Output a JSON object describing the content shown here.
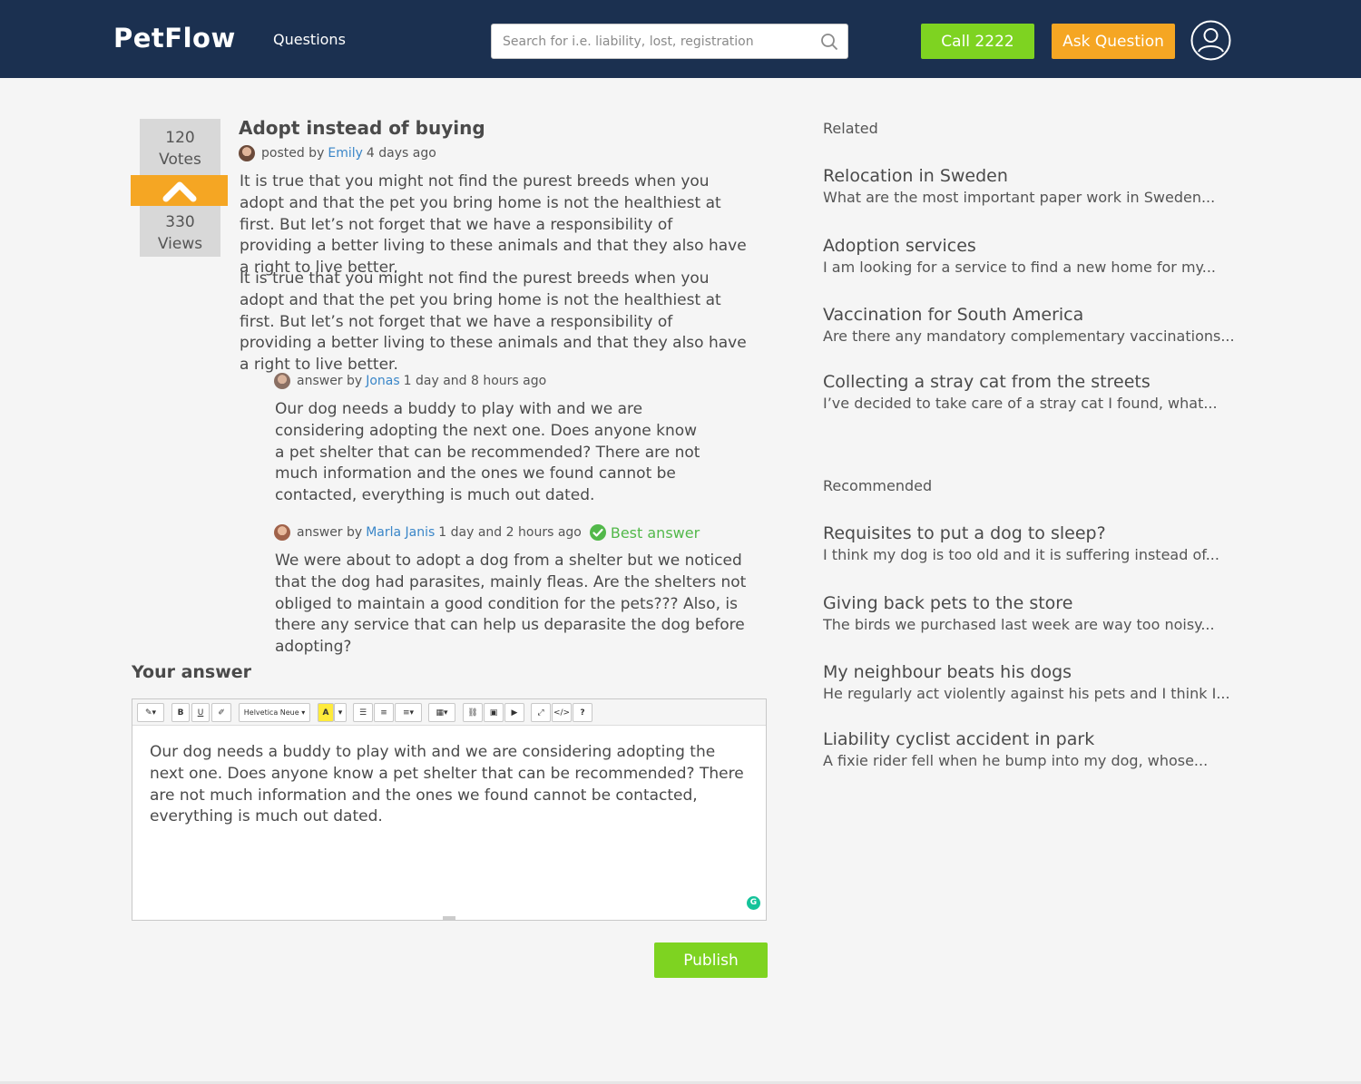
{
  "header": {
    "logo": "PetFlow",
    "nav_questions": "Questions",
    "search_placeholder": "Search for i.e. liability, lost, registration",
    "call_button": "Call 2222",
    "ask_button": "Ask Question"
  },
  "question": {
    "votes": "120",
    "votes_label": "Votes",
    "views": "330",
    "views_label": "Views",
    "title": "Adopt instead of buying",
    "posted_by_prefix": "posted by",
    "author": "Emily",
    "time": "4 days ago",
    "paragraphs": [
      "It is true that you might not find the purest breeds when you adopt and that the pet you bring home is not the healthiest at first. But let’s not forget that we have a responsibility of providing a better living to these animals and that they also have a right to live better.",
      "It is true that you might not find the purest breeds when you adopt and that the pet you bring home is not the healthiest at first. But let’s not forget that we have a responsibility of providing a better living to these animals and that they also have a right to live better."
    ]
  },
  "answers": [
    {
      "prefix": "answer by",
      "author": "Jonas",
      "time": "1 day and 8 hours ago",
      "body": "Our dog needs a buddy to play with and we are considering adopting the next one. Does anyone know a pet shelter that can be recommended? There are not much information and the ones we found cannot be contacted, everything is much out dated."
    },
    {
      "prefix": "answer by",
      "author": "Marla Janis",
      "time": "1 day and 2 hours ago",
      "badge": "Best answer",
      "body": "We were about to adopt a dog from a shelter but we noticed that the dog had parasites, mainly fleas. Are the shelters not obliged to maintain a good condition for the pets??? Also, is there any service that can help us deparasite the dog before adopting?"
    }
  ],
  "your_answer": {
    "heading": "Your answer",
    "font_select": "Helvetica Neue",
    "content": "Our dog needs a buddy to play with and we are considering adopting the next one. Does anyone know a pet shelter that can be recommended? There are not much information and the ones we found cannot be contacted, everything is much out dated.",
    "publish_button": "Publish"
  },
  "related": {
    "heading": "Related",
    "items": [
      {
        "title": "Relocation in Sweden",
        "snippet": "What are the most important paper work in Sweden..."
      },
      {
        "title": "Adoption services",
        "snippet": "I am looking for a service to find a new home for my..."
      },
      {
        "title": "Vaccination for South America",
        "snippet": "Are there any mandatory complementary vaccinations..."
      },
      {
        "title": "Collecting a stray cat from the streets",
        "snippet": "I’ve decided to take care of a stray cat I found, what..."
      }
    ]
  },
  "recommended": {
    "heading": "Recommended",
    "items": [
      {
        "title": "Requisites to put a dog to sleep?",
        "snippet": "I think my dog is too old and it is suffering instead of..."
      },
      {
        "title": "Giving back pets to the store",
        "snippet": "The birds we purchased last week are way too noisy..."
      },
      {
        "title": "My neighbour beats his dogs",
        "snippet": "He regularly act violently against his pets and I think I..."
      },
      {
        "title": "Liability cyclist accident in park",
        "snippet": "A fixie rider fell when he bump into my dog, whose..."
      }
    ]
  },
  "colors": {
    "header_bg": "#1b3050",
    "green": "#7ed321",
    "orange": "#f5a623",
    "link": "#3a86c8",
    "best_answer": "#52b84a"
  },
  "icons": [
    "search-icon",
    "user-circle-icon",
    "chevron-up-icon",
    "check-circle-icon",
    "grammarly-icon"
  ]
}
